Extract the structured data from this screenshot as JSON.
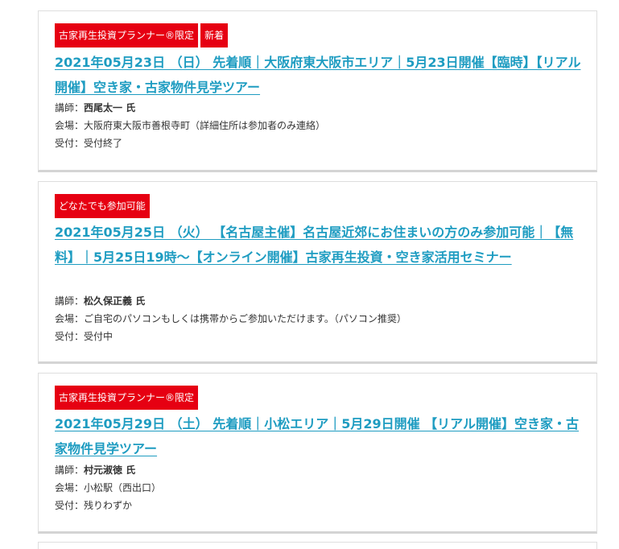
{
  "events": [
    {
      "tags": [
        "古家再生投資プランナー®限定",
        "新着"
      ],
      "title": "2021年05月23日 （日） 先着順｜大阪府東大阪市エリア｜5月23日開催【臨時】【リアル開催】空き家・古家物件見学ツアー",
      "lecturer_label": "講師：",
      "lecturer": "西尾太一 氏",
      "venue_label": "会場：",
      "venue": "大阪府東大阪市善根寺町（詳細住所は参加者のみ連絡）",
      "status_label": "受付：",
      "status": "受付終了"
    },
    {
      "tags": [
        "どなたでも参加可能"
      ],
      "title": "2021年05月25日 （火） 【名古屋主催】名古屋近郊にお住まいの方のみ参加可能｜【無料】｜5月25日19時～【オンライン開催】古家再生投資・空き家活用セミナー",
      "lecturer_label": "講師：",
      "lecturer": "松久保正義 氏",
      "venue_label": "会場：",
      "venue": "ご自宅のパソコンもしくは携帯からご参加いただけます。（パソコン推奨）",
      "status_label": "受付：",
      "status": "受付中"
    },
    {
      "tags": [
        "古家再生投資プランナー®限定"
      ],
      "title": "2021年05月29日 （土） 先着順｜小松エリア｜5月29日開催 【リアル開催】空き家・古家物件見学ツアー",
      "lecturer_label": "講師：",
      "lecturer": "村元淑徳 氏",
      "venue_label": "会場：",
      "venue": "小松駅（西出口）",
      "status_label": "受付：",
      "status": "残りわずか"
    }
  ],
  "colors": {
    "tag_bg": "#e60012",
    "title_link": "#1e9cc1",
    "text": "#333333"
  }
}
